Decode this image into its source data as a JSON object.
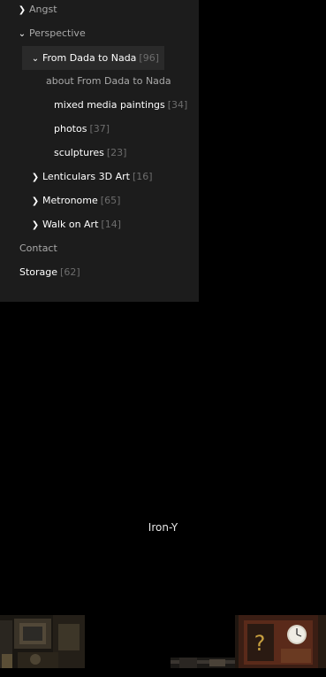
{
  "nav": {
    "angst": {
      "label": "Angst"
    },
    "perspective": {
      "label": "Perspective"
    },
    "from_dada": {
      "label": "From Dada to Nada",
      "count": "[96]"
    },
    "about": {
      "label": "about From Dada to Nada"
    },
    "mixed_media": {
      "label": "mixed media paintings",
      "count": "[34]"
    },
    "photos": {
      "label": "photos",
      "count": "[37]"
    },
    "sculptures": {
      "label": "sculptures",
      "count": "[23]"
    },
    "lenticulars": {
      "label": "Lenticulars 3D Art",
      "count": "[16]"
    },
    "metronome": {
      "label": "Metronome",
      "count": "[65]"
    },
    "walk_on_art": {
      "label": "Walk on Art",
      "count": "[14]"
    },
    "contact": {
      "label": "Contact"
    },
    "storage": {
      "label": "Storage",
      "count": "[62]"
    }
  },
  "main": {
    "caption": "Iron-Y"
  },
  "icons": {
    "collapsed": "chevron-right-icon",
    "expanded": "chevron-down-icon"
  }
}
